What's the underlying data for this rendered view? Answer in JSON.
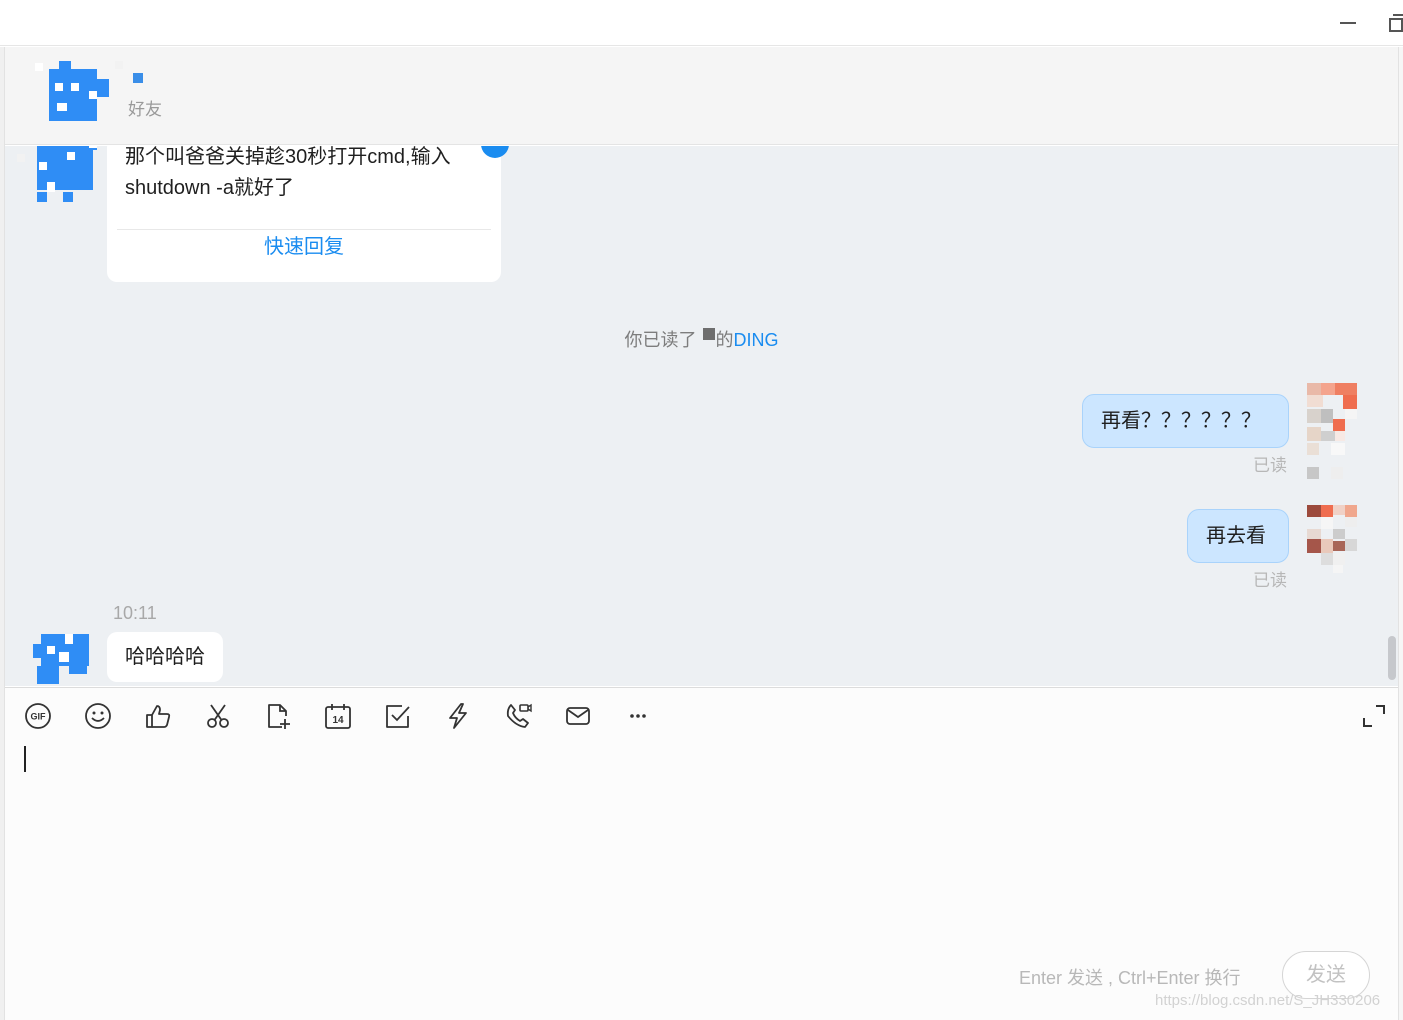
{
  "header": {
    "subtitle": "好友"
  },
  "messages": {
    "card": {
      "text": "那个叫爸爸关掉趁30秒打开cmd,输入shutdown -a就好了",
      "reply_label": "快速回复"
    },
    "system": {
      "prefix": "你已读了",
      "middle": "的",
      "ding": "DING"
    },
    "outgoing": [
      {
        "text": "再看？？？？？？",
        "status": "已读"
      },
      {
        "text": "再去看",
        "status": "已读"
      }
    ],
    "time": "10:11",
    "incoming_last": {
      "text": "哈哈哈哈"
    }
  },
  "composer": {
    "tools": [
      "gif-icon",
      "emoji-icon",
      "thumbs-up-icon",
      "scissors-icon",
      "file-add-icon",
      "calendar-icon",
      "task-check-icon",
      "ding-lightning-icon",
      "call-icon",
      "mail-icon",
      "more-icon",
      "expand-icon"
    ],
    "calendar_day": "14",
    "gif_label": "GIF",
    "hint": "Enter 发送 , Ctrl+Enter 换行",
    "send_label": "发送"
  },
  "watermark": "https://blog.csdn.net/S_JH330206",
  "colors": {
    "accent": "#1a8cf0",
    "outgoing_bubble": "#cce6ff",
    "chat_bg": "#edf0f3"
  }
}
